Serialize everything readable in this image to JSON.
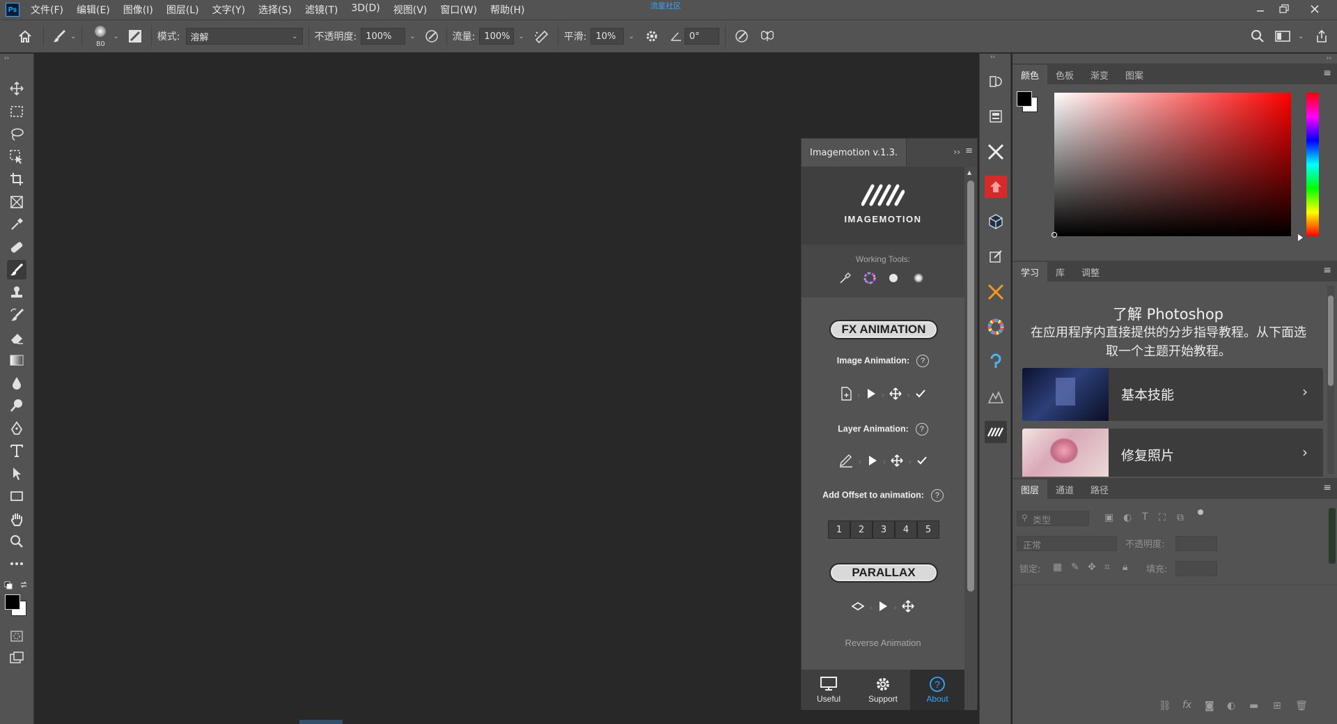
{
  "app": {
    "logo": "Ps",
    "center_title": "流星社区"
  },
  "menu": [
    "文件(F)",
    "编辑(E)",
    "图像(I)",
    "图层(L)",
    "文字(Y)",
    "选择(S)",
    "滤镜(T)",
    "3D(D)",
    "视图(V)",
    "窗口(W)",
    "帮助(H)"
  ],
  "window_controls": [
    "minimize-icon",
    "restore-icon",
    "close-icon"
  ],
  "options": {
    "brush_size": "80",
    "mode_label": "模式:",
    "mode_value": "溶解",
    "opacity_label": "不透明度:",
    "opacity_value": "100%",
    "flow_label": "流量:",
    "flow_value": "100%",
    "smooth_label": "平滑:",
    "smooth_value": "10%",
    "angle_value": "0°"
  },
  "plugin": {
    "tab_title": "Imagemotion v.1.3.",
    "logo_text": "IMAGEMOTION",
    "working_tools_label": "Working Tools:",
    "fx_button": "FX ANIMATION",
    "image_animation_label": "Image Animation:",
    "layer_animation_label": "Layer Animation:",
    "offset_label": "Add Offset to animation:",
    "help_mark": "?",
    "offset_numbers": [
      "1",
      "2",
      "3",
      "4",
      "5"
    ],
    "parallax_button": "PARALLAX",
    "reverse_label": "Reverse Animation",
    "footer": [
      {
        "label": "Useful",
        "icon": "monitor-icon"
      },
      {
        "label": "Support",
        "icon": "gear-icon"
      },
      {
        "label": "About",
        "icon": "help-circle-icon"
      }
    ]
  },
  "color_panel": {
    "tabs": [
      "颜色",
      "色板",
      "渐变",
      "图案"
    ],
    "active_tab": "颜色"
  },
  "learn_panel": {
    "tabs": [
      "学习",
      "库",
      "调整"
    ],
    "title": "了解 Photoshop",
    "description": "在应用程序内直接提供的分步指导教程。从下面选取一个主题开始教程。",
    "cards": [
      {
        "title": "基本技能"
      },
      {
        "title": "修复照片"
      }
    ]
  },
  "layers_panel": {
    "tabs": [
      "图层",
      "通道",
      "路径"
    ],
    "filter_placeholder": "类型",
    "blend_mode": "正常",
    "opacity_label": "不透明度:",
    "lock_label": "锁定:",
    "fill_label": "填充:"
  },
  "colors": {
    "accent": "#31a8ff",
    "ui_bg": "#535353",
    "canvas": "#282828",
    "dark": "#424242"
  }
}
